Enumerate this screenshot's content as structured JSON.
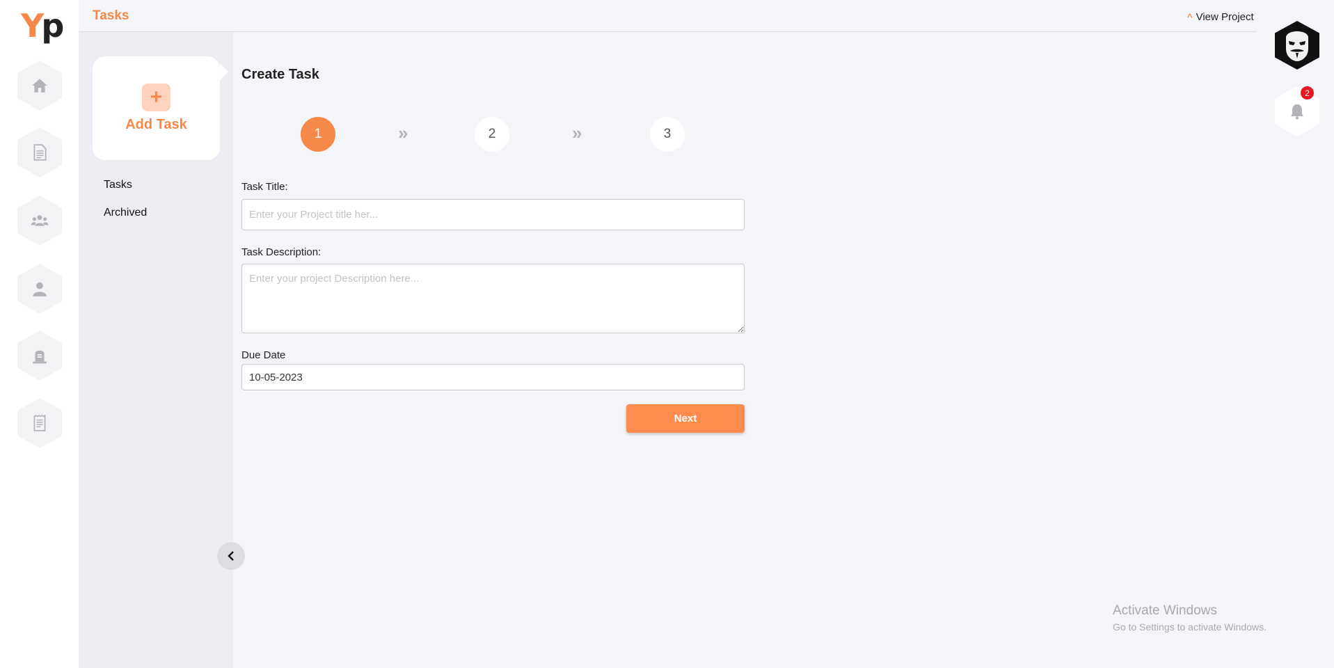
{
  "app": {
    "logo_y": "Y",
    "logo_p": "p"
  },
  "header": {
    "title": "Tasks",
    "view_project": "View Project"
  },
  "rail": {
    "icons": [
      "home-icon",
      "document-icon",
      "users-icon",
      "user-icon",
      "tombstone-icon",
      "receipt-icon"
    ]
  },
  "panel": {
    "add_task_symbol": "+",
    "add_task_label": "Add Task",
    "nav": [
      "Tasks",
      "Archived"
    ]
  },
  "form": {
    "title": "Create Task",
    "steps": [
      "1",
      "2",
      "3"
    ],
    "separator": "»",
    "active_step": 1,
    "task_title_label": "Task Title:",
    "task_title_placeholder": "Enter your Project title her...",
    "task_title_value": "",
    "description_label": "Task Description:",
    "description_placeholder": "Enter your project Description here...",
    "description_value": "",
    "due_date_label": "Due Date",
    "due_date_value": "10-05-2023",
    "next_label": "Next"
  },
  "notifications": {
    "count": "2"
  },
  "colors": {
    "accent": "#f5894a",
    "button": "#ff8c4f",
    "badge": "#e8141e"
  },
  "watermark": {
    "line1": "Activate Windows",
    "line2": "Go to Settings to activate Windows."
  }
}
